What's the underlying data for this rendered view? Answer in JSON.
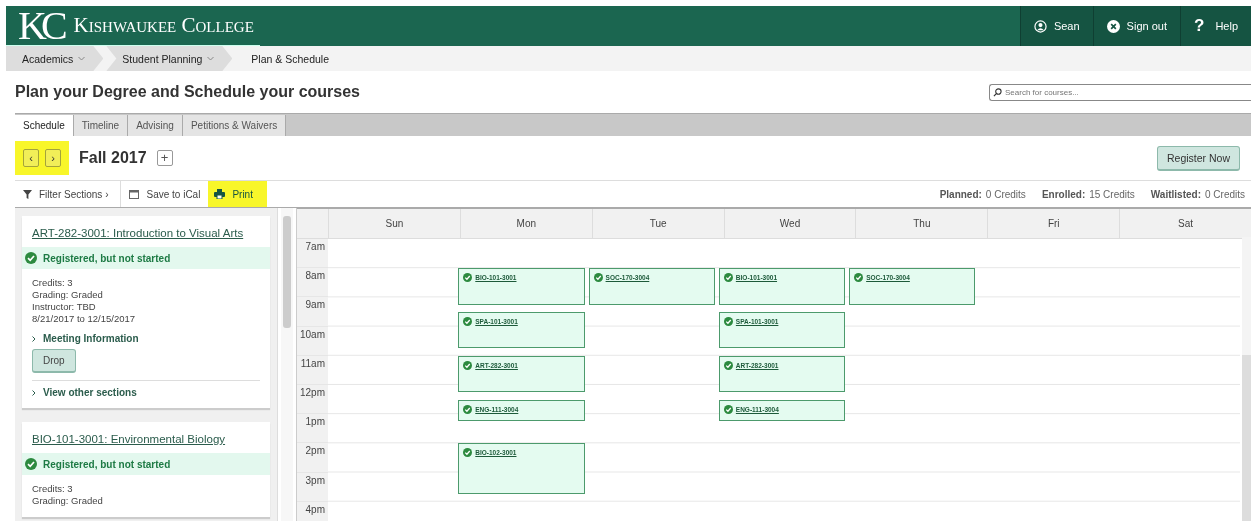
{
  "header": {
    "logo_mark": "KC",
    "logo_name": "Kishwaukee College",
    "user": "Sean",
    "sign_out": "Sign out",
    "help": "Help",
    "help_glyph": "?"
  },
  "breadcrumbs": [
    {
      "label": "Academics",
      "dropdown": true
    },
    {
      "label": "Student Planning",
      "dropdown": true
    },
    {
      "label": "Plan & Schedule",
      "dropdown": false
    }
  ],
  "page_title": "Plan your Degree and Schedule your courses",
  "search": {
    "placeholder": "Search for courses..."
  },
  "tabs": [
    {
      "label": "Schedule",
      "selected": true
    },
    {
      "label": "Timeline",
      "selected": false
    },
    {
      "label": "Advising",
      "selected": false
    },
    {
      "label": "Petitions & Waivers",
      "selected": false
    }
  ],
  "term": {
    "name": "Fall 2017",
    "prev": "‹",
    "next": "›",
    "add": "+",
    "nav_highlighted": true,
    "register": "Register Now"
  },
  "toolbar": {
    "filter": "Filter Sections ›",
    "ical": "Save to iCal",
    "print": "Print",
    "print_highlighted": true,
    "totals": [
      {
        "label": "Planned:",
        "value": "0 Credits"
      },
      {
        "label": "Enrolled:",
        "value": "15 Credits"
      },
      {
        "label": "Waitlisted:",
        "value": "0 Credits"
      }
    ]
  },
  "courses": [
    {
      "title": "ART-282-3001: Introduction to Visual Arts",
      "status": "Registered, but not started",
      "details": [
        "Credits: 3",
        "Grading: Graded",
        "Instructor: TBD",
        "8/21/2017 to 12/15/2017"
      ],
      "meeting": "Meeting Information",
      "action": "Drop",
      "other": "View other sections"
    },
    {
      "title": "BIO-101-3001: Environmental Biology",
      "status": "Registered, but not started",
      "details": [
        "Credits: 3",
        "Grading: Graded"
      ]
    }
  ],
  "calendar": {
    "hours": [
      "7am",
      "8am",
      "9am",
      "10am",
      "11am",
      "12pm",
      "1pm",
      "2pm",
      "3pm",
      "4pm"
    ],
    "days": [
      {
        "label": "Sun"
      },
      {
        "label": "Mon",
        "entries": [
          {
            "kind": "hourgap"
          },
          {
            "kind": "class",
            "code": "BIO-101-3001"
          },
          {
            "kind": "gap"
          },
          {
            "kind": "class",
            "code": "SPA-101-3001"
          },
          {
            "kind": "gap"
          },
          {
            "kind": "class",
            "code": "ART-282-3001"
          },
          {
            "kind": "gap"
          },
          {
            "kind": "short",
            "code": "ENG-111-3004"
          },
          {
            "kind": "gap"
          },
          {
            "kind": "gap"
          },
          {
            "kind": "gap"
          },
          {
            "kind": "long",
            "code": "BIO-102-3001"
          }
        ]
      },
      {
        "label": "Tue",
        "entries": [
          {
            "kind": "hourgap"
          },
          {
            "kind": "class",
            "code": "SOC-170-3004"
          }
        ]
      },
      {
        "label": "Wed",
        "entries": [
          {
            "kind": "hourgap"
          },
          {
            "kind": "class",
            "code": "BIO-101-3001"
          },
          {
            "kind": "gap"
          },
          {
            "kind": "class",
            "code": "SPA-101-3001"
          },
          {
            "kind": "gap"
          },
          {
            "kind": "class",
            "code": "ART-282-3001"
          },
          {
            "kind": "gap"
          },
          {
            "kind": "short",
            "code": "ENG-111-3004"
          }
        ]
      },
      {
        "label": "Thu",
        "entries": [
          {
            "kind": "hourgap"
          },
          {
            "kind": "class",
            "code": "SOC-170-3004"
          }
        ]
      },
      {
        "label": "Fri"
      },
      {
        "label": "Sat"
      }
    ]
  }
}
